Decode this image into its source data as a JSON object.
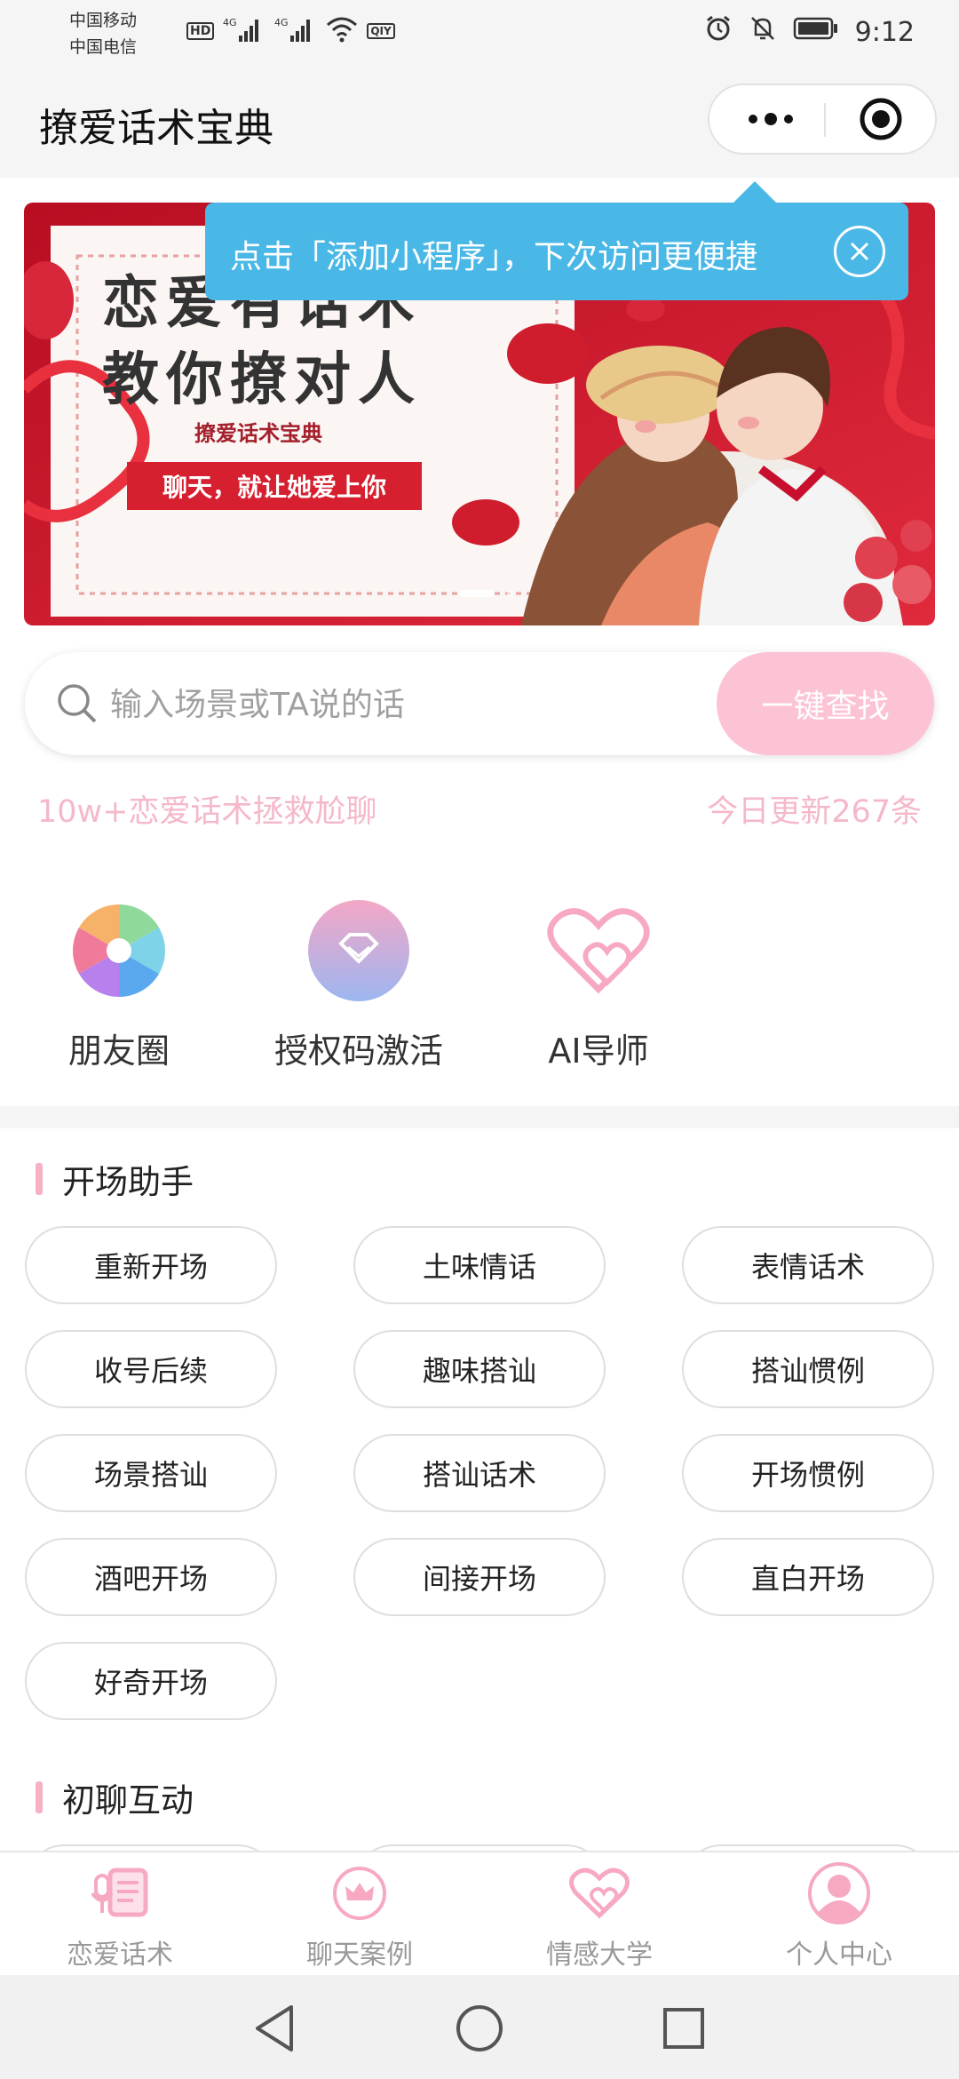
{
  "status": {
    "carrier1": "中国移动",
    "carrier2": "中国电信",
    "hd_badge": "HD",
    "net1": "4G",
    "net2": "4G",
    "qiyi_badge": "QIY",
    "time": "9:12",
    "icons": [
      "signal-icon",
      "wifi-icon",
      "alarm-icon",
      "mute-icon",
      "battery-icon"
    ]
  },
  "nav": {
    "title": "撩爱话术宝典",
    "more_icon": "more-dots-icon",
    "close_icon": "target-close-icon"
  },
  "tooltip": {
    "text": "点击「添加小程序」，下次访问更便捷",
    "color": "#4ab8e6"
  },
  "banner": {
    "line1": "恋爱有话术",
    "line2": "教你撩对人",
    "brand": "撩爱话术宝典",
    "slogan": "聊天，就让她爱上你",
    "slide_count": 2,
    "active_slide": 1
  },
  "search": {
    "placeholder": "输入场景或TA说的话",
    "button": "一键查找"
  },
  "stats": {
    "left": "10w+恋爱话术拯救尬聊",
    "right": "今日更新267条"
  },
  "quick_actions": [
    {
      "label": "朋友圈",
      "icon": "aperture-icon"
    },
    {
      "label": "授权码激活",
      "icon": "diamond-icon"
    },
    {
      "label": "AI导师",
      "icon": "hearts-icon"
    }
  ],
  "sections": [
    {
      "title": "开场助手",
      "pills": [
        "重新开场",
        "土味情话",
        "表情话术",
        "收号后续",
        "趣味搭讪",
        "搭讪惯例",
        "场景搭讪",
        "搭讪话术",
        "开场惯例",
        "酒吧开场",
        "间接开场",
        "直白开场",
        "好奇开场"
      ]
    },
    {
      "title": "初聊互动",
      "pills": []
    }
  ],
  "tabs": [
    {
      "label": "恋爱话术",
      "icon": "mic-list-icon"
    },
    {
      "label": "聊天案例",
      "icon": "crown-icon"
    },
    {
      "label": "情感大学",
      "icon": "double-heart-icon"
    },
    {
      "label": "个人中心",
      "icon": "user-icon"
    }
  ],
  "colors": {
    "accent_pink": "#fcc3d4",
    "text_pink": "#f5b8c9",
    "tooltip_blue": "#4ab8e6",
    "banner_red": "#c8102e"
  }
}
